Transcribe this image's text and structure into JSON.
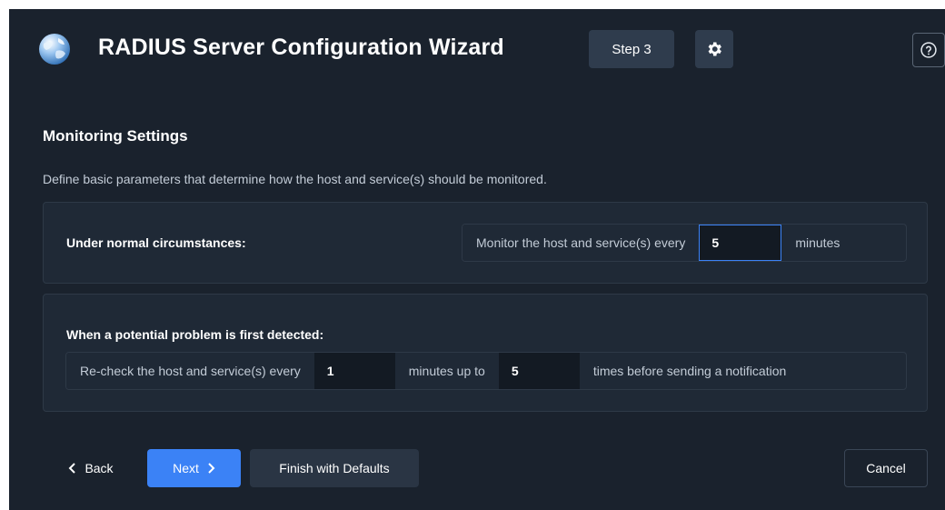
{
  "header": {
    "title": "RADIUS Server Configuration Wizard",
    "step_label": "Step 3",
    "gear_icon": "gear-icon",
    "help_icon": "help-circle-icon",
    "logo_icon": "globe-icon"
  },
  "section": {
    "title": "Monitoring Settings",
    "description": "Define basic parameters that determine how the host and service(s) should be monitored."
  },
  "normal": {
    "label": "Under normal circumstances:",
    "prefix": "Monitor the host and service(s) every",
    "interval_value": "5",
    "suffix": "minutes"
  },
  "problem": {
    "label": "When a potential problem is first detected:",
    "prefix": "Re-check the host and service(s) every",
    "retry_interval_value": "1",
    "middle": "minutes up to",
    "max_attempts_value": "5",
    "suffix": "times before sending a notification"
  },
  "footer": {
    "back_label": "Back",
    "next_label": "Next",
    "defaults_label": "Finish with Defaults",
    "cancel_label": "Cancel"
  },
  "colors": {
    "background": "#1a222d",
    "panel": "#1f2936",
    "accent": "#3b82f6",
    "badge": "#2f3c4d"
  }
}
